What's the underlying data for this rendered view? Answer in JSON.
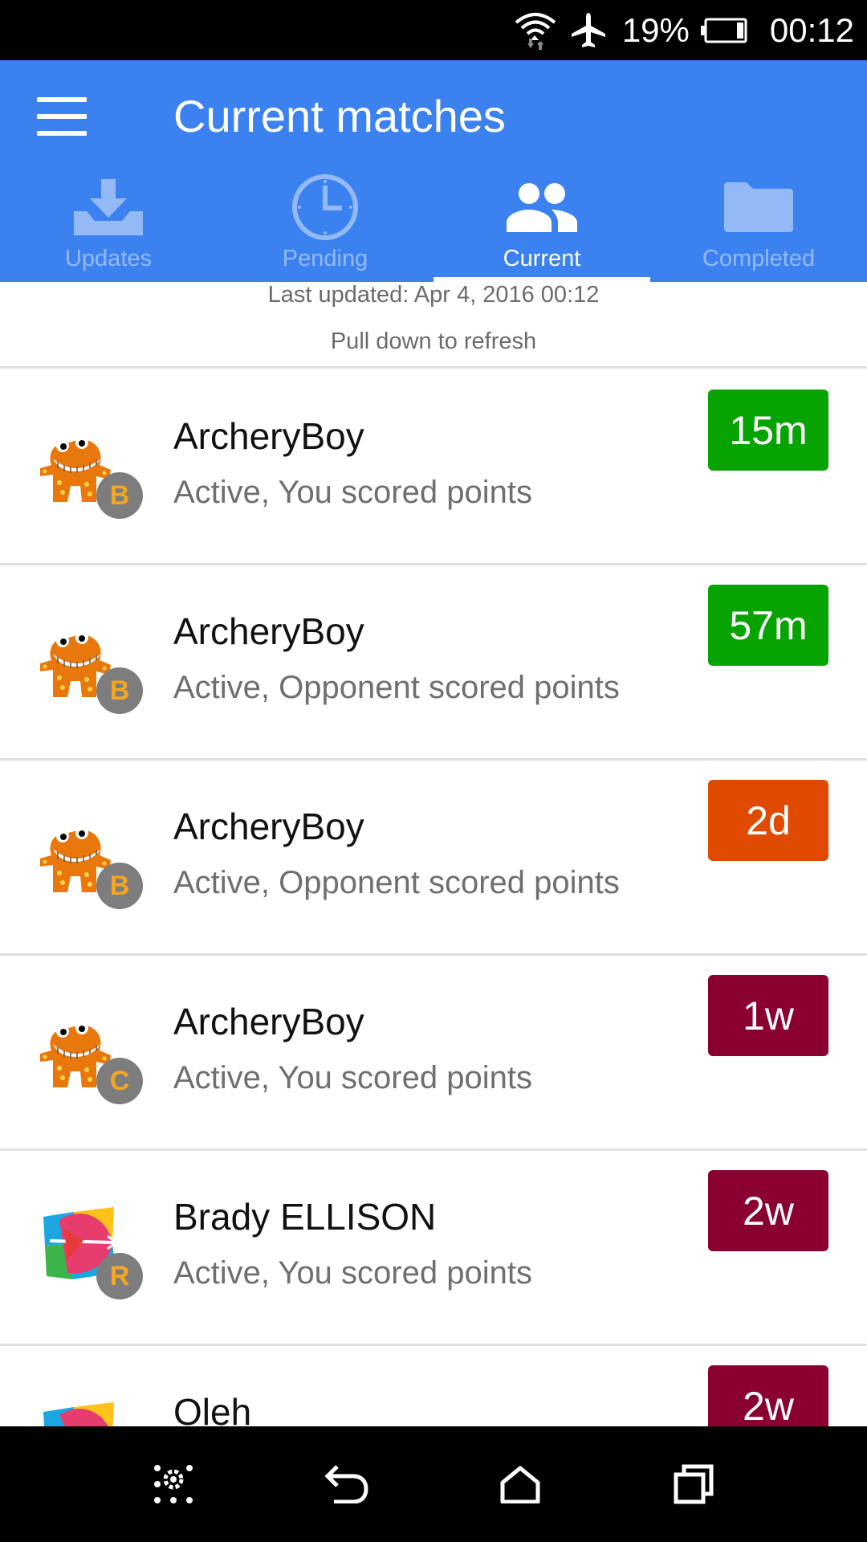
{
  "status_bar": {
    "battery_percent": "19%",
    "time": "00:12",
    "icons": [
      "wifi-icon",
      "airplane-mode-icon",
      "battery-icon"
    ]
  },
  "header": {
    "title": "Current matches",
    "menu_icon": "hamburger-menu-icon"
  },
  "tabs": [
    {
      "label": "Updates",
      "icon": "download-icon",
      "active": false
    },
    {
      "label": "Pending",
      "icon": "clock-icon",
      "active": false
    },
    {
      "label": "Current",
      "icon": "people-icon",
      "active": true
    },
    {
      "label": "Completed",
      "icon": "folder-icon",
      "active": false
    }
  ],
  "refresh": {
    "last_updated": "Last updated: Apr 4, 2016 00:12",
    "hint": "Pull down to refresh"
  },
  "matches": [
    {
      "name": "ArcheryBoy",
      "status": "Active, You scored points",
      "level": "B",
      "time": "15m",
      "time_color": "#07a300",
      "avatar": "monster-avatar"
    },
    {
      "name": "ArcheryBoy",
      "status": "Active, Opponent scored points",
      "level": "B",
      "time": "57m",
      "time_color": "#07a300",
      "avatar": "monster-avatar"
    },
    {
      "name": "ArcheryBoy",
      "status": "Active, Opponent scored points",
      "level": "B",
      "time": "2d",
      "time_color": "#e04a00",
      "avatar": "monster-avatar"
    },
    {
      "name": "ArcheryBoy",
      "status": "Active, You scored points",
      "level": "C",
      "time": "1w",
      "time_color": "#8a0033",
      "avatar": "monster-avatar"
    },
    {
      "name": "Brady ELLISON",
      "status": "Active, You scored points",
      "level": "R",
      "time": "2w",
      "time_color": "#8a0033",
      "avatar": "archery-logo-avatar"
    },
    {
      "name": "Oleh",
      "status": "",
      "level": "",
      "time": "2w",
      "time_color": "#8a0033",
      "avatar": "archery-logo-avatar"
    }
  ],
  "nav_bar": {
    "buttons": [
      "settings-grid-icon",
      "back-icon",
      "home-icon",
      "recent-apps-icon"
    ]
  },
  "colors": {
    "app_bar": "#3b82f0",
    "badge_green": "#07a300",
    "badge_orange": "#e04a00",
    "badge_maroon": "#8a0033"
  }
}
